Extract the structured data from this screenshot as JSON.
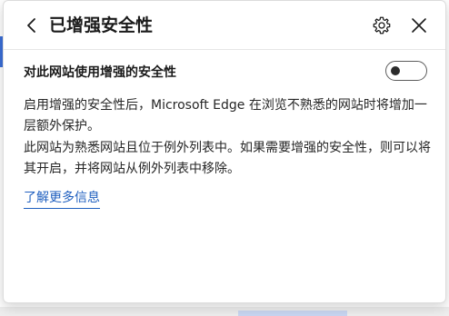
{
  "header": {
    "title": "已增强安全性"
  },
  "setting": {
    "label": "对此网站使用增强的安全性",
    "enabled": false
  },
  "body": {
    "paragraph1": "启用增强的安全性后，Microsoft Edge 在浏览不熟悉的网站时将增加一层额外保护。",
    "paragraph2": "此网站为熟悉网站且位于例外列表中。如果需要增强的安全性，则可以将其开启，并将网站从例外列表中移除。",
    "learn_more": "了解更多信息"
  },
  "icons": {
    "back": "chevron-left-icon",
    "settings": "gear-icon",
    "close": "close-icon"
  },
  "colors": {
    "link": "#1f5fbf",
    "text": "#1a1a1a",
    "accent": "#3b6fd8"
  }
}
